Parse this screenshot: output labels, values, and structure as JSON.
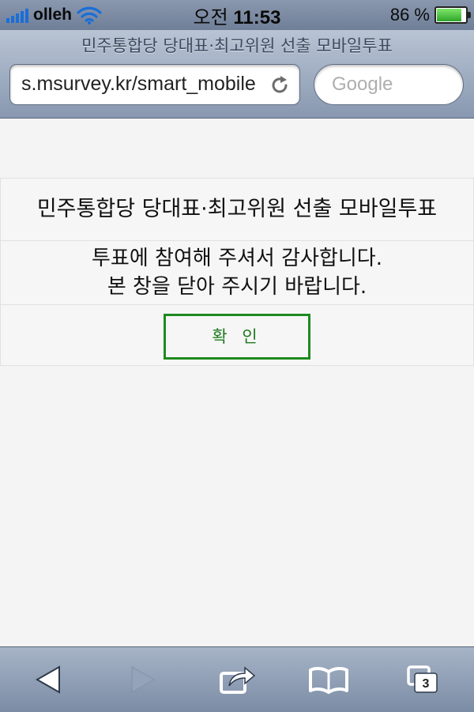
{
  "status_bar": {
    "carrier": "olleh",
    "time_prefix": "오전",
    "time": "11:53",
    "battery_percent": "86 %",
    "battery_level": 0.86
  },
  "browser": {
    "page_title": "민주통합당 당대표·최고위원 선출 모바일투표",
    "url": "s.msurvey.kr/smart_mobile",
    "search_placeholder": "Google"
  },
  "content": {
    "title": "민주통합당 당대표·최고위원 선출 모바일투표",
    "message_line1": "투표에 참여해 주셔서 감사합니다.",
    "message_line2": "본 창을 닫아 주시기 바랍니다.",
    "confirm_label": "확 인"
  },
  "toolbar": {
    "tab_count": "3"
  },
  "colors": {
    "accent_green": "#1e8a1e",
    "signal_blue": "#1a6ed8"
  }
}
